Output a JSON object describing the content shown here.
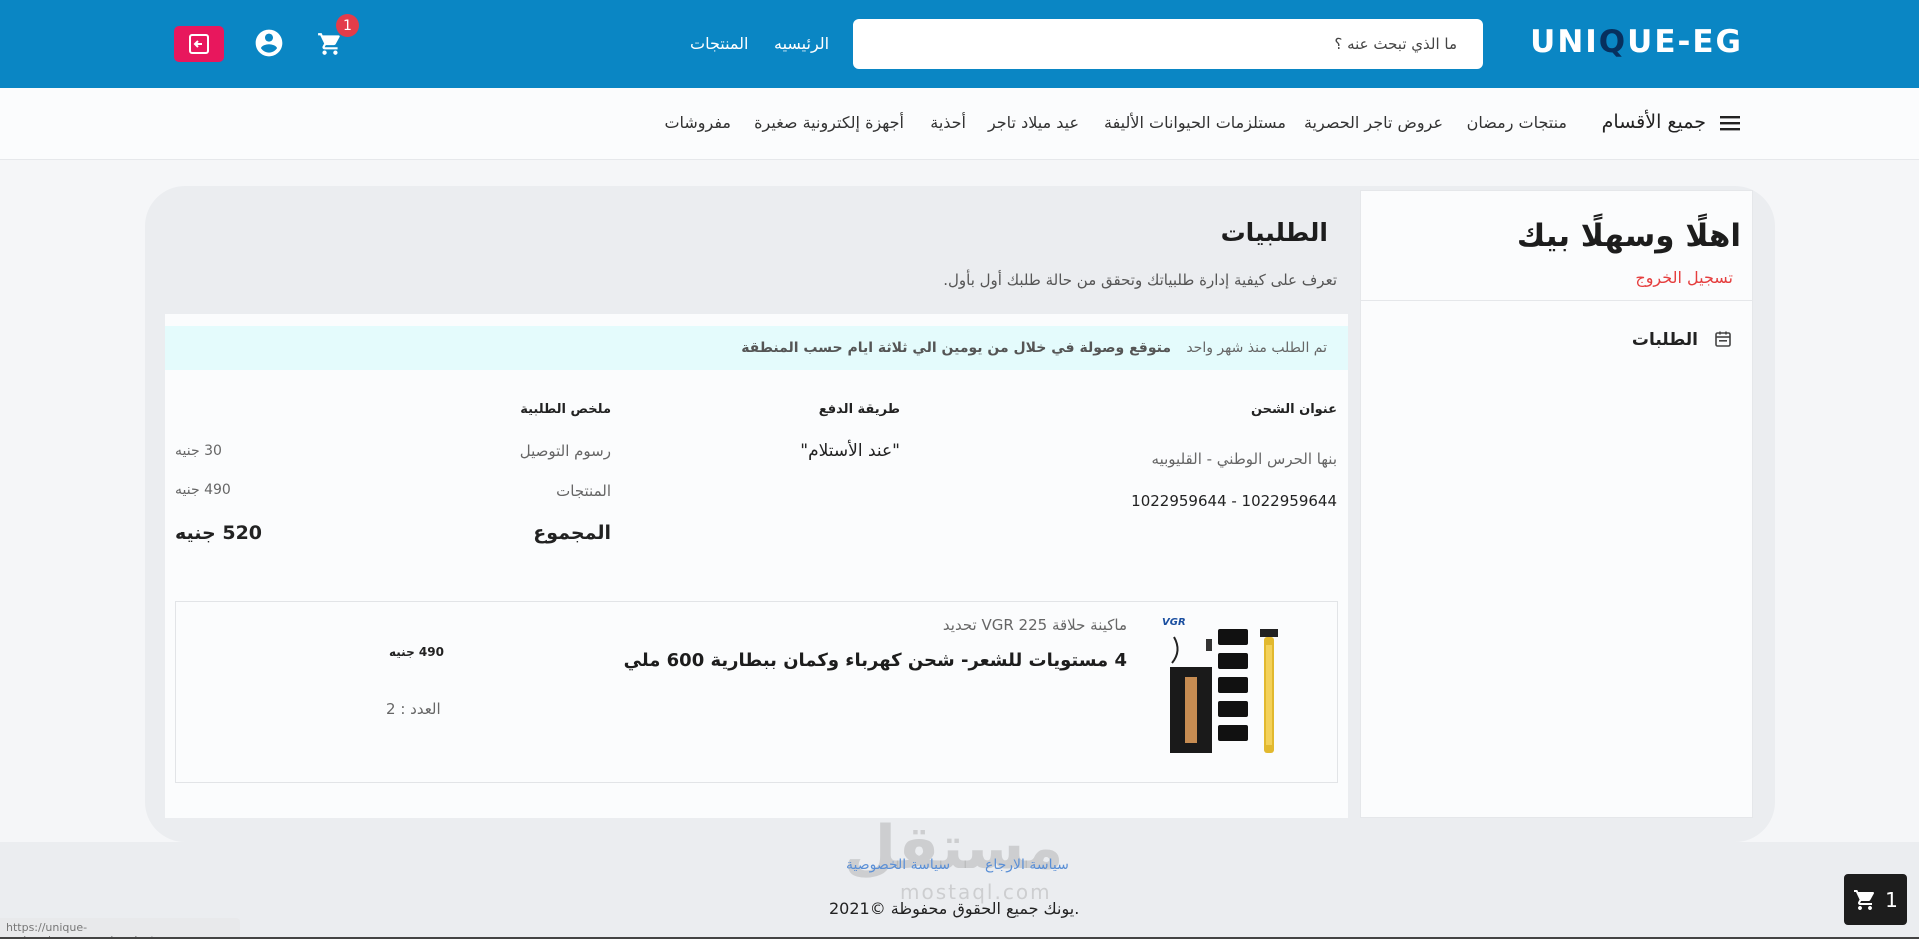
{
  "header": {
    "logo_pre": "UNI",
    "logo_q": "Q",
    "logo_post": "UE-EG",
    "search_placeholder": "ما الذي تبحث عنه ؟",
    "nav_home": "الرئيسيه",
    "nav_products": "المنتجات",
    "cart_count": "1"
  },
  "categories": {
    "all": "جميع الأقسام",
    "items": [
      "منتجات رمضان",
      "عروض تاجر الحصرية",
      "مستلزمات الحيوانات الأليفة",
      "عيد ميلاد تاجر",
      "أحذية",
      "أجهزة إلكترونية صغيرة",
      "مفروشات"
    ]
  },
  "sidebar": {
    "welcome": "اهلًا وسهلًا بيك",
    "logout": "تسجيل الخروج",
    "orders": "الطلبات"
  },
  "main": {
    "title": "الطلبيات",
    "subtitle": "تعرف على كيفية إدارة طلبياتك وتحقق من حالة طلبك أول بأول.",
    "notice_time": "تم الطلب منذ شهر واحد",
    "notice_eta": "متوقع وصولة في خلال من يومين الي ثلاثة ايام حسب المنطقة",
    "shipping_header": "عنوان الشحن",
    "address": "بنها الحرس الوطني - القليوبيه",
    "phone": "1022959644 - 1022959644",
    "payment_header": "طريقة الدفع",
    "payment_method": "\"عند الأستلام\"",
    "summary_header": "ملخص الطلبية",
    "delivery_label": "رسوم التوصيل",
    "delivery_value": "30 جنيه",
    "products_label": "المنتجات",
    "products_value": "490 جنيه",
    "total_label": "المجموع",
    "total_value": "520 جنيه"
  },
  "item": {
    "brand_line": "ماكينة حلاقة VGR 225 تحديد",
    "name": "4 مستويات للشعر- شحن كهرباء وكمان ببطارية 600 ملي",
    "price": "490 جنيه",
    "qty": "العدد : 2"
  },
  "footer": {
    "return_policy": "سياسة الارجاع",
    "privacy_policy": "سياسة الخصوصية",
    "copyright": "يونك جميع الحقوق محفوظة ©2021.",
    "watermark": "مستقل",
    "watermark_sub": "mostaql.com",
    "status_url": "https://unique-eg.herokuapp.com/products",
    "float_cart_count": "1"
  },
  "colors": {
    "header_bg": "#0a86c4",
    "logout_btn": "#e8175d",
    "badge": "#e33c4a",
    "logout_link": "#e53e3e"
  }
}
